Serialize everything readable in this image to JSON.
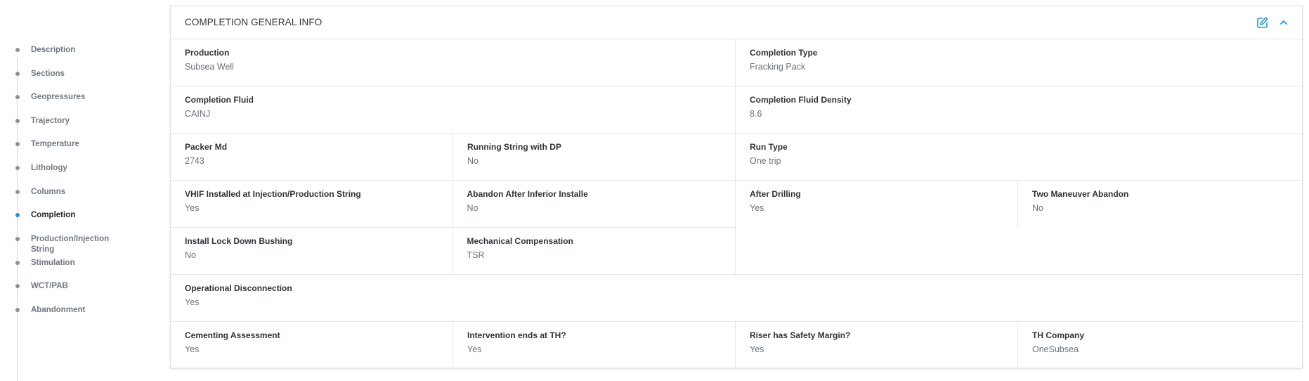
{
  "sidebar": {
    "items": [
      {
        "label": "Description",
        "active": false
      },
      {
        "label": "Sections",
        "active": false
      },
      {
        "label": "Geopressures",
        "active": false
      },
      {
        "label": "Trajectory",
        "active": false
      },
      {
        "label": "Temperature",
        "active": false
      },
      {
        "label": "Lithology",
        "active": false
      },
      {
        "label": "Columns",
        "active": false
      },
      {
        "label": "Completion",
        "active": true
      },
      {
        "label": "Production/Injection String",
        "active": false
      },
      {
        "label": "Stimulation",
        "active": false
      },
      {
        "label": "WCT/PAB",
        "active": false
      },
      {
        "label": "Abandonment",
        "active": false
      }
    ]
  },
  "panel": {
    "title": "COMPLETION GENERAL INFO",
    "icons": {
      "edit": "edit-icon",
      "collapse": "chevron-up-icon"
    },
    "accent": "#2d8fd5",
    "fields": {
      "production": {
        "label": "Production",
        "value": "Subsea Well"
      },
      "completion_type": {
        "label": "Completion Type",
        "value": "Fracking Pack"
      },
      "completion_fluid": {
        "label": "Completion Fluid",
        "value": "CAINJ"
      },
      "completion_fluid_density": {
        "label": "Completion Fluid Density",
        "value": "8.6"
      },
      "packer_md": {
        "label": "Packer Md",
        "value": "2743"
      },
      "running_string_dp": {
        "label": "Running String with DP",
        "value": "No"
      },
      "run_type": {
        "label": "Run Type",
        "value": "One trip"
      },
      "vhif_installed": {
        "label": "VHIF Installed at Injection/Production String",
        "value": "Yes"
      },
      "abandon_after_inferior": {
        "label": "Abandon After Inferior Installe",
        "value": "No"
      },
      "after_drilling": {
        "label": "After Drilling",
        "value": "Yes"
      },
      "two_maneuver_abandon": {
        "label": "Two Maneuver Abandon",
        "value": "No"
      },
      "install_lock_down": {
        "label": "Install Lock Down Bushing",
        "value": "No"
      },
      "mechanical_compensation": {
        "label": "Mechanical Compensation",
        "value": "TSR"
      },
      "operational_disconnection": {
        "label": "Operational Disconnection",
        "value": "Yes"
      },
      "cementing_assessment": {
        "label": "Cementing Assessment",
        "value": "Yes"
      },
      "intervention_ends_th": {
        "label": "Intervention ends at TH?",
        "value": "Yes"
      },
      "riser_safety_margin": {
        "label": "Riser has Safety Margin?",
        "value": "Yes"
      },
      "th_company": {
        "label": "TH Company",
        "value": "OneSubsea"
      }
    }
  }
}
